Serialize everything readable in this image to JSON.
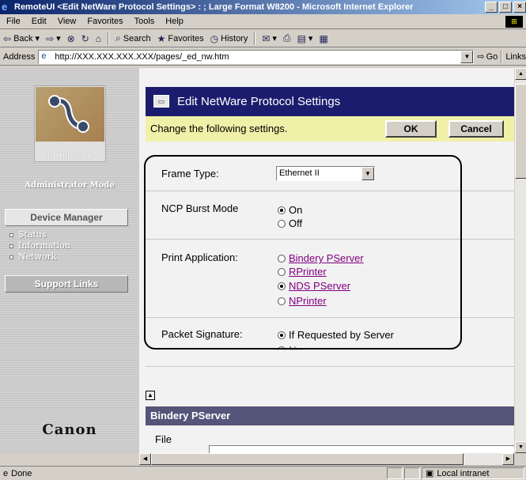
{
  "window": {
    "title": "RemoteUI <Edit NetWare Protocol Settings> : ; Large Format W8200 - Microsoft Internet Explorer",
    "minimize": "_",
    "maximize": "□",
    "close": "×"
  },
  "menu": [
    "File",
    "Edit",
    "View",
    "Favorites",
    "Tools",
    "Help"
  ],
  "toolbar": {
    "back": "Back",
    "search": "Search",
    "favorites": "Favorites",
    "history": "History"
  },
  "address": {
    "label": "Address",
    "url": "http://XXX.XXX.XXX.XXX/pages/_ed_nw.htm",
    "go": "Go",
    "links": "Links"
  },
  "sidebar": {
    "home_label": "To Top page",
    "admin_mode": "Administrator Mode",
    "device_manager": "Device Manager",
    "nav": [
      "Status",
      "Information",
      "Network"
    ],
    "support_links": "Support Links",
    "brand": "Canon"
  },
  "main": {
    "title": "Edit NetWare Protocol Settings",
    "instruction": "Change the following settings.",
    "ok": "OK",
    "cancel": "Cancel",
    "frame_type": {
      "label": "Frame Type:",
      "value": "Ethernet II"
    },
    "ncp_burst": {
      "label": "NCP Burst Mode",
      "options": [
        "On",
        "Off"
      ],
      "selected": "On"
    },
    "print_app": {
      "label": "Print Application:",
      "options": [
        "Bindery PServer",
        "RPrinter",
        "NDS PServer",
        "NPrinter"
      ],
      "selected": "NDS PServer"
    },
    "packet_sig": {
      "label": "Packet Signature:",
      "option": "If Requested by Server",
      "partial_option": "No"
    },
    "bindery_section": "Bindery PServer",
    "file_label": "File"
  },
  "status": {
    "text": "Done",
    "zone": "Local intranet"
  }
}
